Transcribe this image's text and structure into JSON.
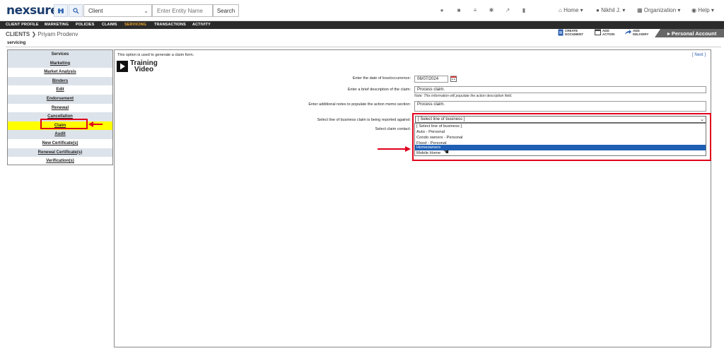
{
  "topbar": {
    "logo": "nexsure",
    "client_select": "Client",
    "entity_placeholder": "Enter Entity Name",
    "search_label": "Search",
    "nav": {
      "home": "Home",
      "user": "Nikhil J.",
      "organization": "Organization",
      "help": "Help"
    }
  },
  "tabs": [
    "CLIENT PROFILE",
    "MARKETING",
    "POLICIES",
    "CLAIMS",
    "SERVICING",
    "TRANSACTIONS",
    "ACTIVITY"
  ],
  "active_tab": "SERVICING",
  "breadcrumb": {
    "section": "CLIENTS",
    "client": "Priyam Prodenv"
  },
  "actions": {
    "create_document": [
      "CREATE",
      "DOCUMENT"
    ],
    "add_action": [
      "ADD",
      "ACTION"
    ],
    "add_delivery": [
      "ADD",
      "DELIVERY"
    ]
  },
  "personal_account": "Personal Account",
  "subtab": "servicing",
  "sidebar": {
    "items": [
      {
        "label": "Services"
      },
      {
        "label": "Marketing"
      },
      {
        "label": "Market Analysis"
      },
      {
        "label": "Binders"
      },
      {
        "label": "Edit"
      },
      {
        "label": "Endorsement"
      },
      {
        "label": "Renewal"
      },
      {
        "label": "Cancellation"
      },
      {
        "label": "Claim"
      },
      {
        "label": "Audit"
      },
      {
        "label": "New Certificate(s)"
      },
      {
        "label": "Renewal Certificate(s)"
      },
      {
        "label": "Verification(s)"
      }
    ]
  },
  "main": {
    "intro": "This option is used to generate a claim form.",
    "next": "[ Next ]",
    "training_line1": "Training",
    "training_line2": "Video",
    "date_label": "Enter the date of loss/occurrence:",
    "date_value": "06/07/2024",
    "desc_label": "Enter a brief description of the claim:",
    "desc_value": "Process claim.",
    "desc_note": "Note: This information will populate the action description field.",
    "memo_label": "Enter additional notes to populate the action memo section:",
    "memo_value": "Process claim.",
    "lob_label": "Select line of business claim is being reported against:",
    "lob_selected": "[ Select line of business ]",
    "contact_label": "Select claim contact:",
    "lob_options": [
      "[ Select line of business ]",
      "Auto - Personal",
      "Condo owners - Personal",
      "Flood - Personal",
      "Homeowners",
      "Mobile Home"
    ],
    "highlighted_option": "Homeowners"
  },
  "colors": {
    "accent_red": "#e0001b",
    "highlight_yellow": "#ffff00",
    "select_blue": "#1e5fb4",
    "tab_active": "#f0a830"
  }
}
